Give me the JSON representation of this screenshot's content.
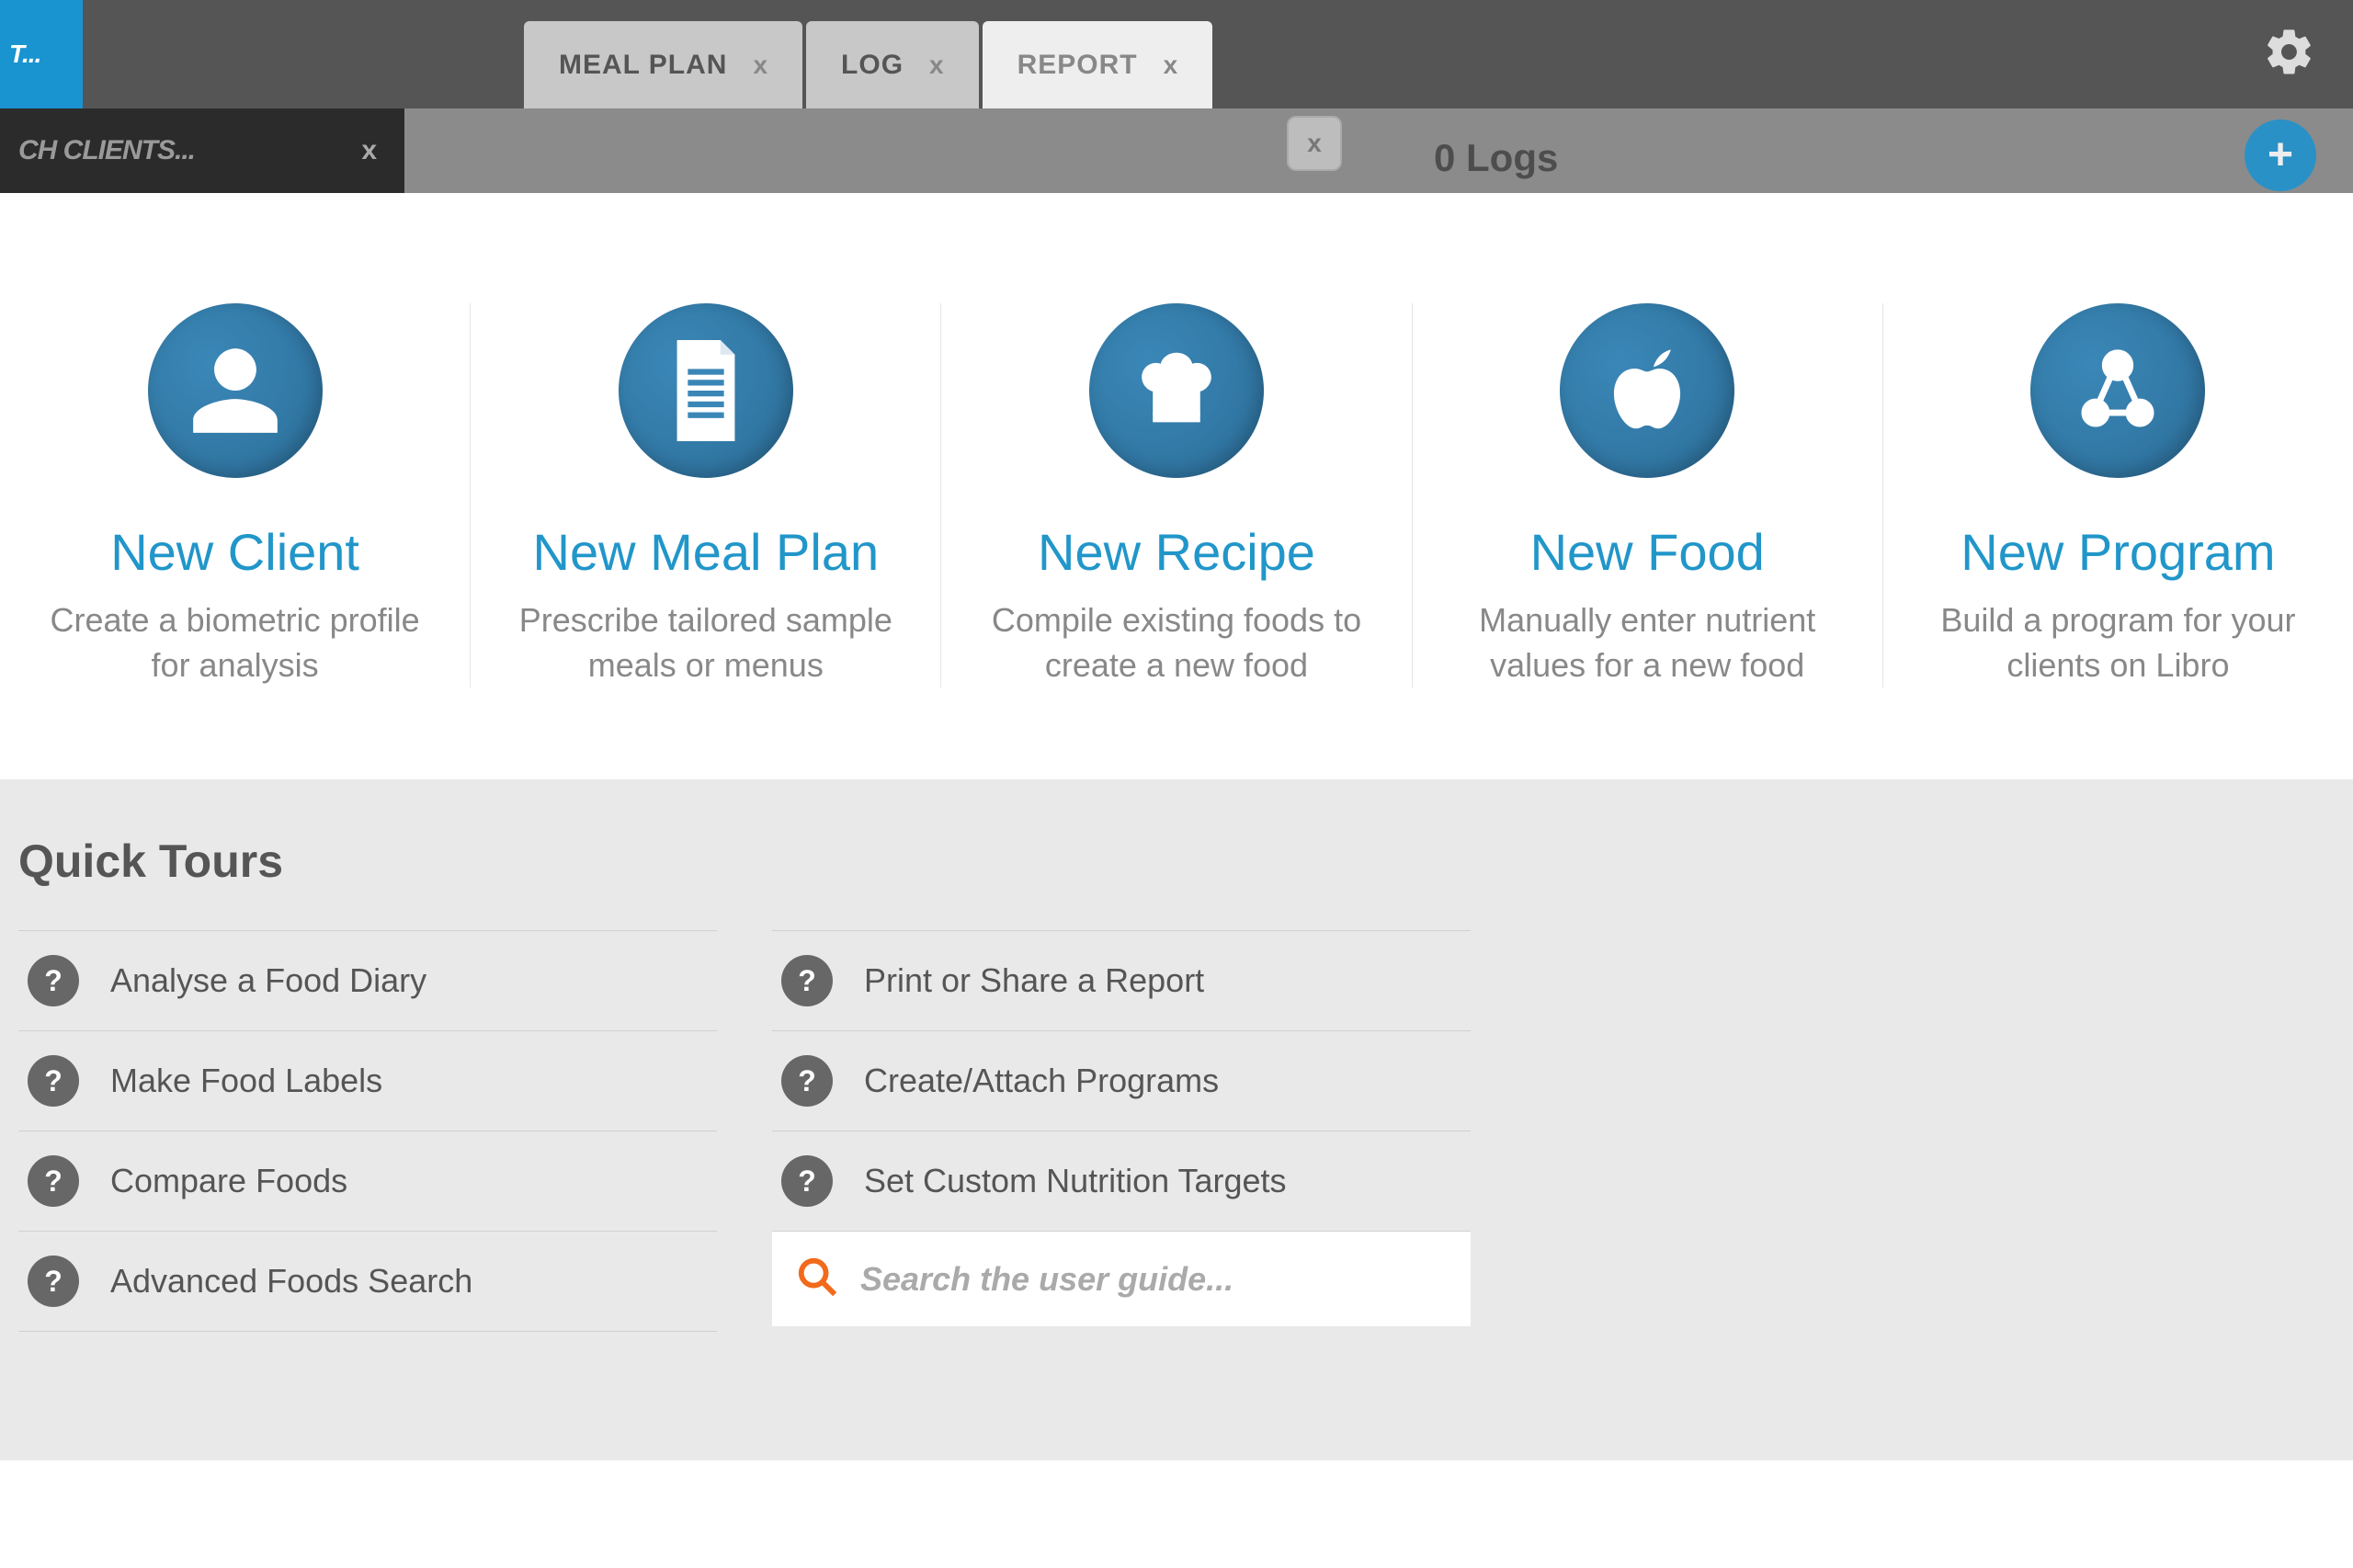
{
  "topbar": {
    "left_stub": "T...",
    "tabs": [
      {
        "label": "MEAL PLAN",
        "active": false
      },
      {
        "label": "LOG",
        "active": false
      },
      {
        "label": "REPORT",
        "active": true
      }
    ]
  },
  "secondbar": {
    "search_clients_placeholder": "CH CLIENTS...",
    "logs_peek": "0 Logs"
  },
  "cards": [
    {
      "id": "new-client",
      "title": "New Client",
      "desc": "Create a biometric profile for analysis",
      "icon": "person"
    },
    {
      "id": "new-meal-plan",
      "title": "New Meal Plan",
      "desc": "Prescribe tailored sample meals or menus",
      "icon": "document"
    },
    {
      "id": "new-recipe",
      "title": "New Recipe",
      "desc": "Compile existing foods to create a new food",
      "icon": "chef-hat"
    },
    {
      "id": "new-food",
      "title": "New Food",
      "desc": "Manually enter nutrient values for a new food",
      "icon": "apple"
    },
    {
      "id": "new-program",
      "title": "New Program",
      "desc": "Build a program for your clients on Libro",
      "icon": "network"
    }
  ],
  "tours": {
    "heading": "Quick Tours",
    "col1": [
      "Analyse a Food Diary",
      "Make Food Labels",
      "Compare Foods",
      "Advanced Foods Search"
    ],
    "col2": [
      "Print or Share a Report",
      "Create/Attach Programs",
      "Set Custom Nutrition Targets"
    ],
    "search_placeholder": "Search the user guide..."
  }
}
